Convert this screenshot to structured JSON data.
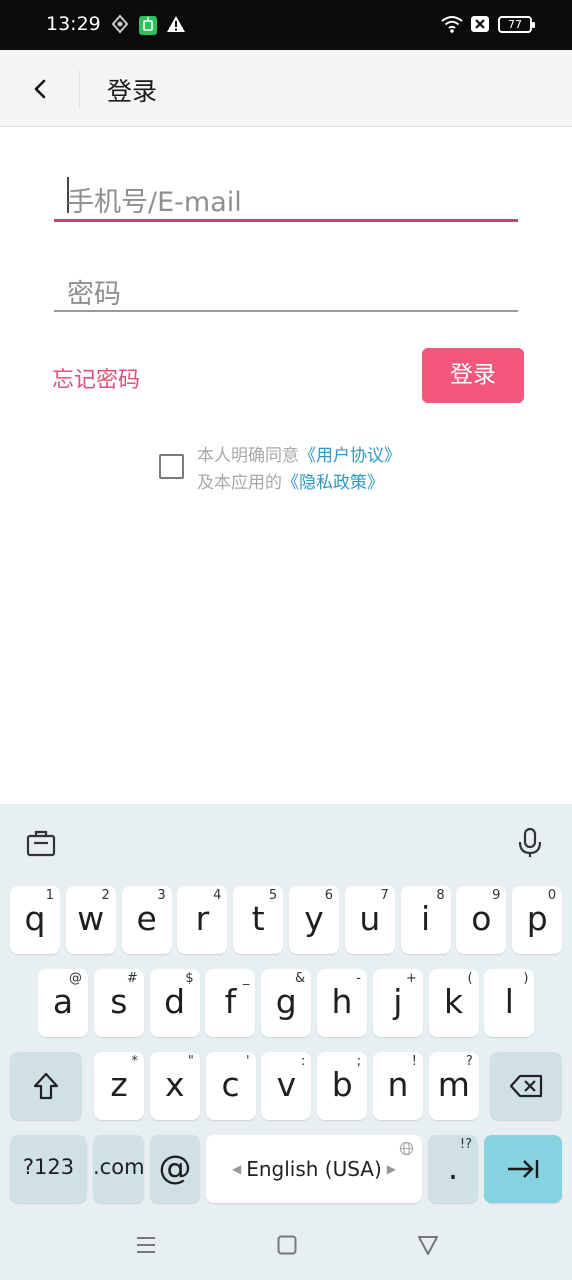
{
  "status_bar": {
    "time": "13:29",
    "battery": "77",
    "icons": [
      "location-icon",
      "android-notification-icon",
      "warning-icon",
      "wifi-icon",
      "sim-off-icon",
      "battery-icon"
    ]
  },
  "app_bar": {
    "back_icon": "chevron-left-icon",
    "title": "登录"
  },
  "form": {
    "phone_placeholder": "手机号/E-mail",
    "password_placeholder": "密码",
    "forgot_password": "忘记密码",
    "login_button": "登录",
    "agreement_prefix": "本人明确同意",
    "user_agreement": "《用户协议》",
    "agreement_middle": "及本应用的",
    "privacy_policy": "《隐私政策》",
    "agreement_checked": false
  },
  "keyboard": {
    "row1": [
      {
        "k": "q",
        "h": "1"
      },
      {
        "k": "w",
        "h": "2"
      },
      {
        "k": "e",
        "h": "3"
      },
      {
        "k": "r",
        "h": "4"
      },
      {
        "k": "t",
        "h": "5"
      },
      {
        "k": "y",
        "h": "6"
      },
      {
        "k": "u",
        "h": "7"
      },
      {
        "k": "i",
        "h": "8"
      },
      {
        "k": "o",
        "h": "9"
      },
      {
        "k": "p",
        "h": "0"
      }
    ],
    "row2": [
      {
        "k": "a",
        "h": "@"
      },
      {
        "k": "s",
        "h": "#"
      },
      {
        "k": "d",
        "h": "$"
      },
      {
        "k": "f",
        "h": "_"
      },
      {
        "k": "g",
        "h": "&"
      },
      {
        "k": "h",
        "h": "-"
      },
      {
        "k": "j",
        "h": "+"
      },
      {
        "k": "k",
        "h": "("
      },
      {
        "k": "l",
        "h": ")"
      }
    ],
    "row3": [
      {
        "k": "z",
        "h": "*"
      },
      {
        "k": "x",
        "h": "\""
      },
      {
        "k": "c",
        "h": "'"
      },
      {
        "k": "v",
        "h": ":"
      },
      {
        "k": "b",
        "h": ";"
      },
      {
        "k": "n",
        "h": "!"
      },
      {
        "k": "m",
        "h": "?"
      }
    ],
    "symbols_key": "?123",
    "dotcom_key": ".com",
    "at_key": "@",
    "space_label": "English (USA)",
    "period_key": ".",
    "period_hint": "!?"
  },
  "colors": {
    "accent": "#f5577c",
    "link": "#2e98c8",
    "focus_underline": "#d83b6e"
  }
}
